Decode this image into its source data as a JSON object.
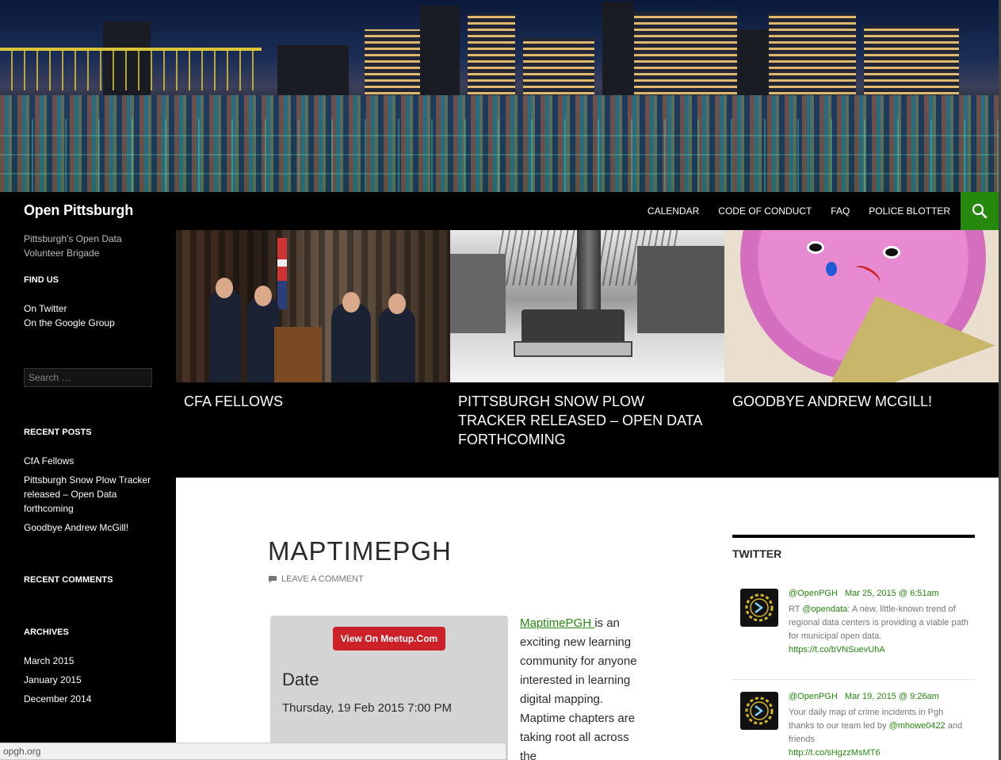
{
  "site": {
    "title": "Open Pittsburgh",
    "tagline": "Pittsburgh's Open Data Volunteer Brigade"
  },
  "nav": {
    "items": [
      {
        "label": "CALENDAR"
      },
      {
        "label": "CODE OF CONDUCT"
      },
      {
        "label": "FAQ"
      },
      {
        "label": "POLICE BLOTTER"
      }
    ],
    "search_icon": "search-icon",
    "accent_color": "#24890d"
  },
  "sidebar": {
    "find_us": {
      "title": "FIND US",
      "links": [
        "On Twitter",
        "On the Google Group"
      ]
    },
    "search": {
      "placeholder": "Search …"
    },
    "recent_posts": {
      "title": "RECENT POSTS",
      "items": [
        "CfA Fellows",
        "Pittsburgh Snow Plow Tracker released – Open Data forthcoming",
        "Goodbye Andrew McGill!"
      ]
    },
    "recent_comments": {
      "title": "RECENT COMMENTS"
    },
    "archives": {
      "title": "ARCHIVES",
      "items": [
        "March 2015",
        "January 2015",
        "December 2014"
      ]
    }
  },
  "featured": [
    {
      "title": "CFA FELLOWS"
    },
    {
      "title": "PITTSBURGH SNOW PLOW TRACKER RELEASED – OPEN DATA FORTHCOMING"
    },
    {
      "title": "GOODBYE ANDREW MCGILL!"
    }
  ],
  "post": {
    "title": "MAPTIMEPGH",
    "comment_link": "LEAVE A COMMENT",
    "meetup_button": "View On Meetup.Com",
    "date_label": "Date",
    "date_value": "Thursday, 19 Feb 2015 7:00 PM",
    "body_link": "MaptimePGH ",
    "body_text": "is an exciting new learning community for anyone interested in learning  digital mapping. Maptime chapters are taking root all across the"
  },
  "twitter": {
    "title": "TWITTER",
    "tweets": [
      {
        "user": "@OpenPGH",
        "time": "Mar 25, 2015 @ 6:51am",
        "prefix": "RT ",
        "mention": "@opendata",
        "text": ": A new, little-known trend of regional data centers is providing a viable path for municipal open data.",
        "link": "https://t.co/bVNSuevUhA"
      },
      {
        "user": "@OpenPGH",
        "time": "Mar 19, 2015 @ 9:26am",
        "prefix": "Your daily map of crime incidents in Pgh thanks to our team led by ",
        "mention": "@mhowe0422",
        "text": " and friends",
        "link": "http://t.co/sHgzzMsMT6"
      }
    ]
  },
  "statusbar": {
    "url": "opgh.org"
  }
}
